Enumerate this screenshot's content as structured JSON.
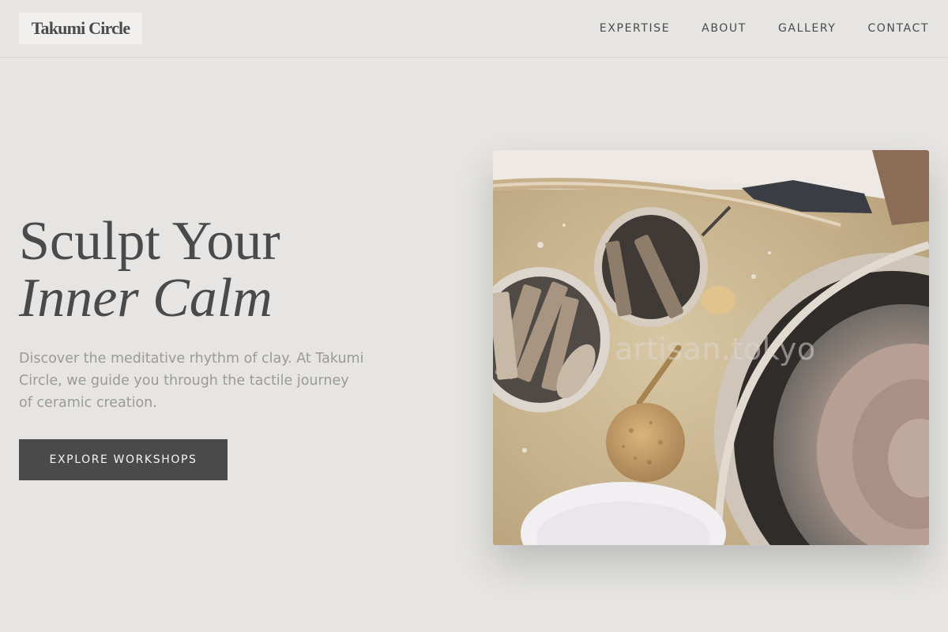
{
  "header": {
    "logo": "Takumi Circle",
    "nav": [
      "EXPERTISE",
      "ABOUT",
      "GALLERY",
      "CONTACT"
    ]
  },
  "hero": {
    "title_line1": "Sculpt Your",
    "title_line2": "Inner Calm",
    "description": "Discover the meditative rhythm of clay. At Takumi Circle, we guide you through the tactile journey of ceramic creation.",
    "cta_label": "EXPLORE WORKSHOPS",
    "image": {
      "alt": "Pottery tools and clay on a pottery wheel",
      "watermark": "artisan.tokyo"
    }
  },
  "colors": {
    "background": "#e6e5e3",
    "text": "#4a4a4a",
    "muted_text": "#9b9a98",
    "button": "#4a4a4a"
  }
}
